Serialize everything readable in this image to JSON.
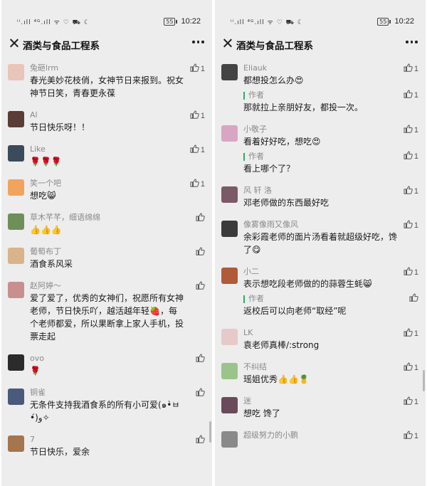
{
  "status": {
    "signal_text": "ⁱⁱ.ıll ⁴ᴳ.ıll ᯤ ♡ ⛟ ☾",
    "battery": "55",
    "time": "10:22"
  },
  "header": {
    "title": "酒类与食品工程系"
  },
  "left": {
    "comments": [
      {
        "nick": "兔砸lrm",
        "text": "春光美妙花枝俏，女神节日来报到。祝女神节日笑，青春更永葆",
        "likes": "1",
        "avatar_color": "#e9c4b8",
        "initial": "兔"
      },
      {
        "nick": "Al",
        "text": "节日快乐呀！！",
        "likes": "1",
        "avatar_color": "#5a3e36",
        "initial": "Al"
      },
      {
        "nick": "Like",
        "text": "🌹🌹🌹",
        "likes": "1",
        "avatar_color": "#3b4b5c",
        "initial": "L"
      },
      {
        "nick": "笑一个吧",
        "text": "想吃😸",
        "likes": "1",
        "avatar_color": "#f2a35e",
        "initial": "笑"
      },
      {
        "nick": "草木芊芊，细语绵绵",
        "text": "👍👍👍",
        "likes": "",
        "avatar_color": "#6f8f5a",
        "initial": "草"
      },
      {
        "nick": "葡萄布丁",
        "text": "酒食系风采",
        "likes": "",
        "avatar_color": "#d9b48a",
        "initial": "葡"
      },
      {
        "nick": "赵阿婷～",
        "text": "爱了爱了，优秀的女神们，祝愿所有女神老师，节日快乐吖，越活越年轻🍓，每个老师都爱，所以果断拿上家人手机，投票走起",
        "likes": "",
        "avatar_color": "#c98f8f",
        "initial": "赵"
      },
      {
        "nick": "ovo",
        "text": "🌹",
        "likes": "",
        "avatar_color": "#2b2b2b",
        "initial": "o"
      },
      {
        "nick": "铜雀",
        "text": "无条件支持我酒食系的所有小可爱(๑•̀ㅂ•́)و✧",
        "likes": "",
        "avatar_color": "#4a5a7a",
        "initial": "铜"
      },
      {
        "nick": "7",
        "text": "节日快乐，爱余",
        "likes": "",
        "avatar_color": "#a5754e",
        "initial": "7"
      }
    ]
  },
  "right": {
    "comments": [
      {
        "nick": "Eliauk",
        "text": "都想投怎么办😍",
        "likes": "1",
        "avatar_color": "#444",
        "initial": "E",
        "reply": {
          "tag": "作者",
          "text": "那就拉上亲朋好友，都投一次。",
          "likes": "1"
        }
      },
      {
        "nick": "小敬子",
        "text": "看着好好吃，想吃😍",
        "likes": "1",
        "avatar_color": "#d8a6c4",
        "initial": "小",
        "reply": {
          "tag": "作者",
          "text": "看上哪个了？",
          "likes": "1"
        }
      },
      {
        "nick": "风 轩 洛",
        "text": "邓老师做的东西最好吃",
        "likes": "1",
        "avatar_color": "#7a5a66",
        "initial": "风"
      },
      {
        "nick": "像雾像雨又像风",
        "text": "余彩霞老师的面片汤看着就超级好吃，馋了😋",
        "likes": "1",
        "avatar_color": "#3b3b3b",
        "initial": "像"
      },
      {
        "nick": "小二",
        "text": "表示想吃段老师做的的蒜蓉生蚝😸",
        "likes": "1",
        "avatar_color": "#b05a3a",
        "initial": "二",
        "reply": {
          "tag": "作者",
          "text": "返校后可以向老师“取经”呢",
          "likes": ""
        }
      },
      {
        "nick": "LK",
        "text": "袁老师真棒/:strong",
        "likes": "1",
        "avatar_color": "#e7c9c9",
        "initial": "LK"
      },
      {
        "nick": "不纠结",
        "text": "瑶姐优秀👍👍🍍",
        "likes": "1",
        "avatar_color": "#9bc48a",
        "initial": "不"
      },
      {
        "nick": "迷",
        "text": "想吃 馋了",
        "likes": "1",
        "avatar_color": "#6a4a5a",
        "initial": "迷"
      },
      {
        "nick": "超级努力的小鹏",
        "text": "",
        "likes": "1",
        "avatar_color": "#8a8a8a",
        "initial": "超"
      }
    ]
  }
}
